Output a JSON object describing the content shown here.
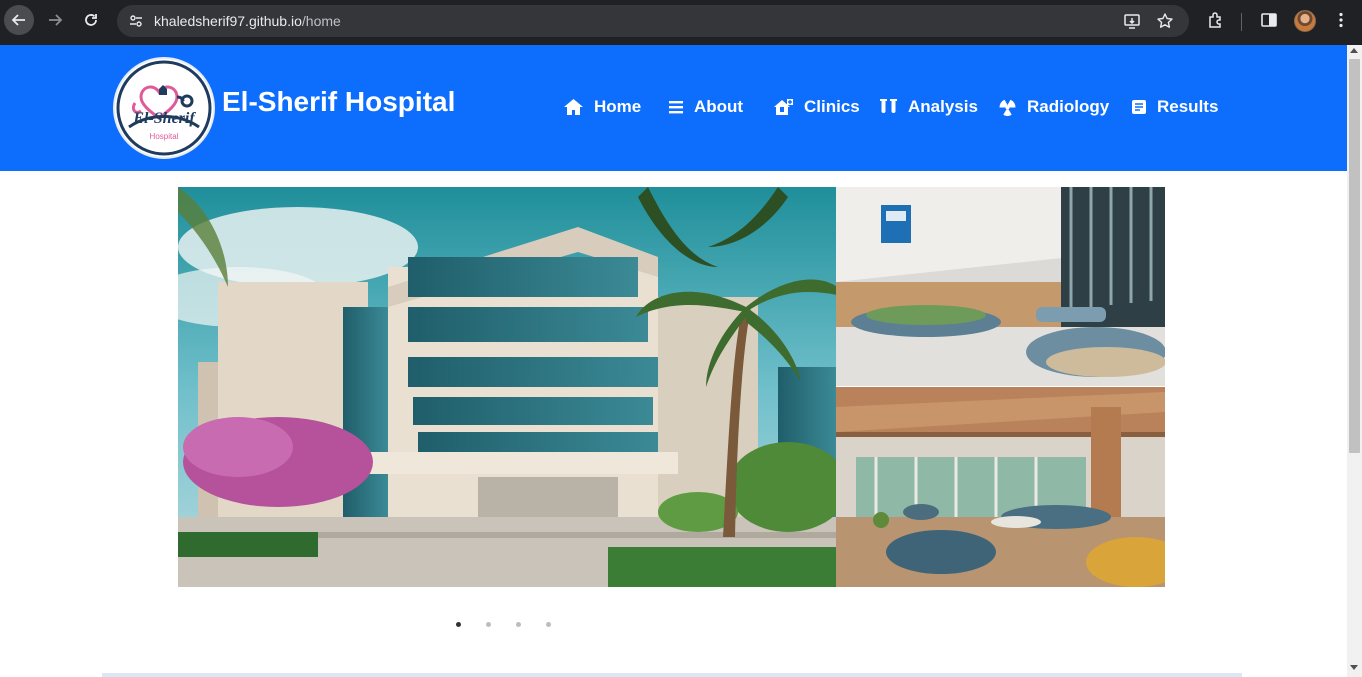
{
  "browser": {
    "url_host": "khaledsherif97.github.io",
    "url_path": "/home",
    "icons": [
      "back-arrow-icon",
      "forward-arrow-icon",
      "reload-icon",
      "site-info-icon",
      "install-app-icon",
      "bookmark-star-icon",
      "extensions-icon",
      "side-panel-icon",
      "profile-avatar",
      "more-menu-icon"
    ]
  },
  "site": {
    "brand": "El-Sherif Hospital",
    "logo": {
      "name": "El-Sherif",
      "sub": "Hospital"
    },
    "colors": {
      "navbar": "#0d6efd",
      "logo_pink": "#e05a9a",
      "logo_navy": "#1f3b5e"
    }
  },
  "nav": {
    "items": [
      {
        "label": "Home",
        "icon": "home-icon"
      },
      {
        "label": "About",
        "icon": "bars-icon"
      },
      {
        "label": "Clinics",
        "icon": "clinic-icon"
      },
      {
        "label": "Analysis",
        "icon": "test-tubes-icon"
      },
      {
        "label": "Radiology",
        "icon": "radiation-icon"
      },
      {
        "label": "Results",
        "icon": "results-icon"
      }
    ]
  },
  "carousel": {
    "slides": 4,
    "active_index": 0,
    "images": [
      "hospital-exterior-photo",
      "hospital-lobby-photo",
      "hospital-waiting-area-photo"
    ]
  }
}
